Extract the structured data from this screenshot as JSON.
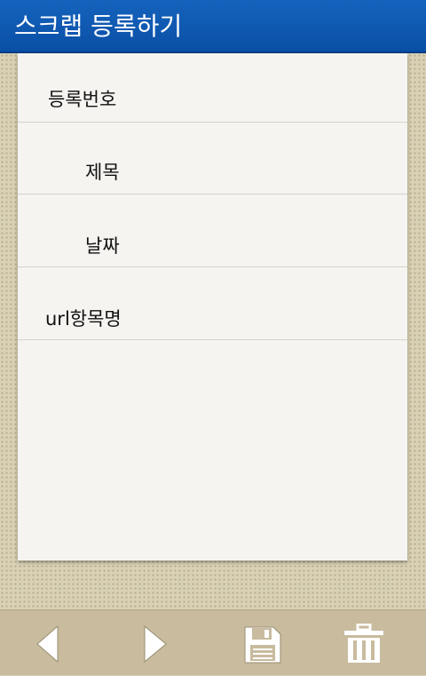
{
  "header": {
    "title": "스크랩 등록하기"
  },
  "form": {
    "fields": [
      {
        "label": "등록번호"
      },
      {
        "label": "제목"
      },
      {
        "label": "날짜"
      },
      {
        "label": "url항목명"
      }
    ]
  },
  "toolbar": {
    "buttons": [
      {
        "icon": "prev-arrow-icon"
      },
      {
        "icon": "next-arrow-icon"
      },
      {
        "icon": "save-icon"
      },
      {
        "icon": "trash-icon"
      }
    ]
  },
  "colors": {
    "titlebar": "#0a4fa6",
    "card": "#f5f4f1",
    "toolbar": "#c8bb9e",
    "icon": "#ffffff"
  }
}
